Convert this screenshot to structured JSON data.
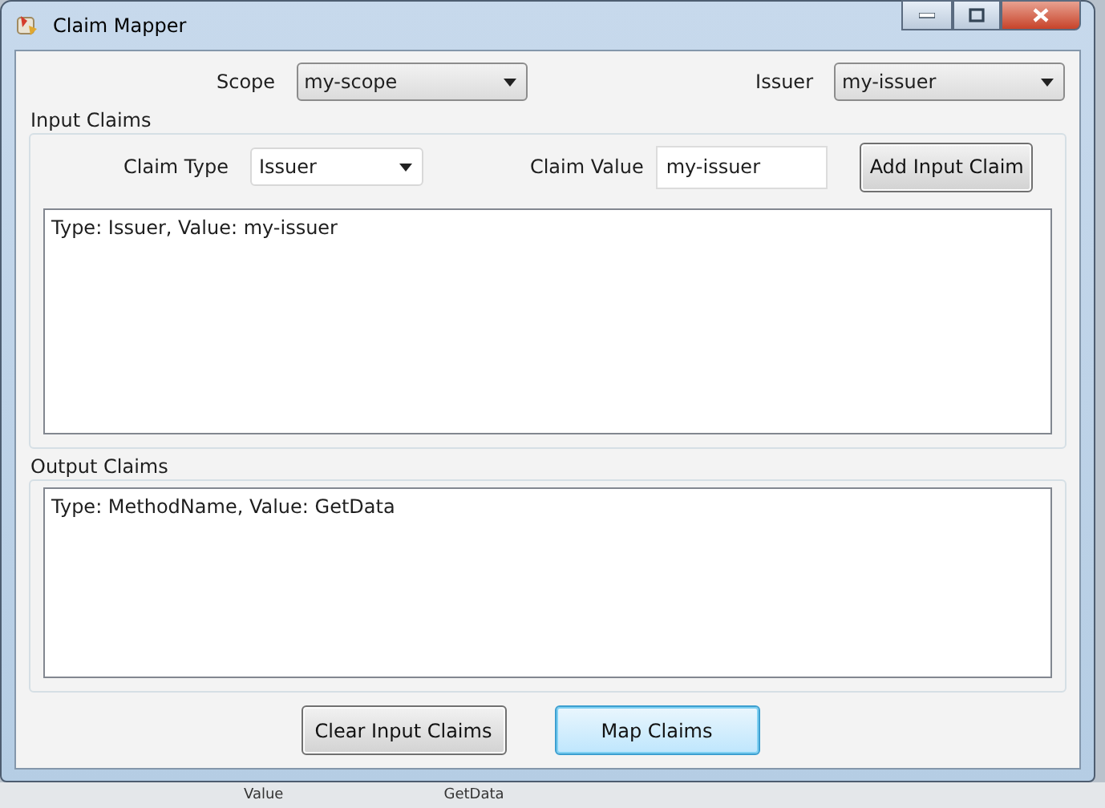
{
  "window": {
    "title": "Claim Mapper"
  },
  "scope": {
    "label": "Scope",
    "value": "my-scope"
  },
  "issuer": {
    "label": "Issuer",
    "value": "my-issuer"
  },
  "input_claims": {
    "title": "Input Claims",
    "claim_type": {
      "label": "Claim Type",
      "value": "Issuer"
    },
    "claim_value": {
      "label": "Claim Value",
      "value": "my-issuer"
    },
    "add_button": "Add Input Claim",
    "items": [
      "Type: Issuer, Value: my-issuer"
    ]
  },
  "output_claims": {
    "title": "Output Claims",
    "items": [
      "Type: MethodName, Value: GetData"
    ]
  },
  "buttons": [
    {
      "label": "Clear Input Claims",
      "focused": false
    },
    {
      "label": "Map Claims",
      "focused": true
    }
  ],
  "background_window": {
    "cells": [
      "Value",
      "GetData"
    ]
  }
}
